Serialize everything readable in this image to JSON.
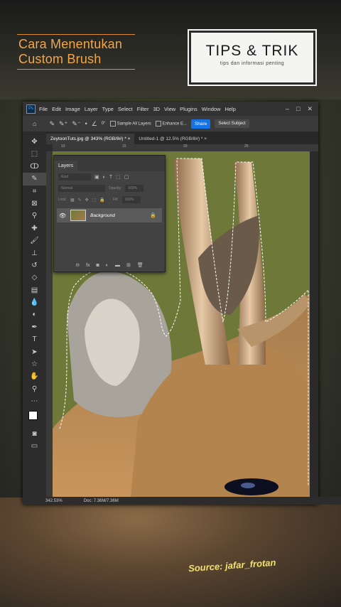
{
  "overlay": {
    "title_line1": "Cara Menentukan",
    "title_line2": "Custom Brush",
    "tips_main": "TIPS & TRIK",
    "tips_sub": "tips dan informasi penting",
    "source": "Source: jafar_frotan"
  },
  "app": {
    "logo": "Ps",
    "menu": [
      "File",
      "Edit",
      "Image",
      "Layer",
      "Type",
      "Select",
      "Filter",
      "3D",
      "View",
      "Plugins",
      "Window",
      "Help"
    ],
    "window_controls": [
      "–",
      "□",
      "✕"
    ]
  },
  "options": {
    "angle": "0°",
    "sample_all_layers": "Sample All Layers",
    "enhance_edge": "Enhance E...",
    "share": "Share",
    "select_subject": "Select Subject"
  },
  "tabs": [
    {
      "label": "ZeytoonTuts.jpg @ 343% (RGB/8#) *",
      "close": "×"
    },
    {
      "label": "Untitled-1 @ 12.5% (RGB/8#) *",
      "close": "×"
    }
  ],
  "ruler": [
    "10",
    "15",
    "20",
    "25"
  ],
  "tools": [
    "move-icon",
    "marquee-icon",
    "lasso-icon",
    "quick-select-icon",
    "crop-icon",
    "frame-icon",
    "eyedropper-icon",
    "healing-icon",
    "brush-icon",
    "stamp-icon",
    "history-brush-icon",
    "eraser-icon",
    "gradient-icon",
    "blur-icon",
    "dodge-icon",
    "pen-icon",
    "type-icon",
    "path-select-icon",
    "shape-icon",
    "hand-icon",
    "zoom-icon",
    "more-icon"
  ],
  "layers_panel": {
    "title": "Layers",
    "kind": "Kind",
    "blend_mode": "Normal",
    "opacity_label": "Opacity:",
    "opacity_value": "100%",
    "lock_label": "Lock:",
    "fill_label": "Fill:",
    "fill_value": "100%",
    "layer_name": "Background"
  },
  "status": {
    "zoom": "342.53%",
    "doc": "Doc: 7.36M/7.36M"
  }
}
